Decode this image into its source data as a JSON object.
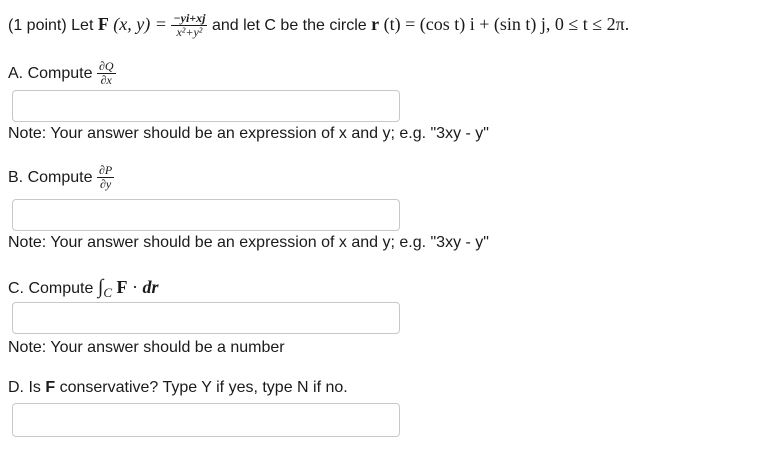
{
  "header": {
    "points": "(1 point) Let",
    "F": "F",
    "args": "(x, y) =",
    "frac_num": "−yi+xj",
    "frac_den": "x²+y²",
    "mid_text": "and let C be the circle",
    "r": "r",
    "r_arg": "(t) = (cos t) i + (sin t) j, 0 ≤ t ≤ 2π."
  },
  "part_a": {
    "label": "A. Compute",
    "num": "∂Q",
    "den": "∂x",
    "answer": "",
    "note": "Note: Your answer should be an expression of x and y; e.g. \"3xy - y\""
  },
  "part_b": {
    "label": "B. Compute",
    "num": "∂P",
    "den": "∂y",
    "answer": "",
    "note": "Note: Your answer should be an expression of x and y; e.g. \"3xy - y\""
  },
  "part_c": {
    "label": "C. Compute",
    "integral": "∫",
    "sub": "C",
    "F": "F",
    "dot": " · ",
    "dr": "dr",
    "answer": "",
    "note": "Note: Your answer should be a number"
  },
  "part_d": {
    "label_pre": "D. Is",
    "F": "F",
    "label_post": "conservative? Type Y if yes, type N if no.",
    "answer": ""
  }
}
